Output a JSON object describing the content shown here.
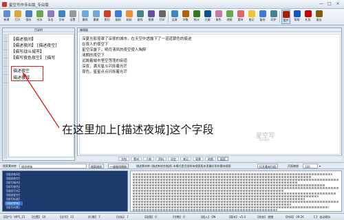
{
  "window": {
    "title": "星空写作专业版_专业版",
    "controls": [
      "—",
      "□",
      "×"
    ]
  },
  "toolbar": {
    "items": [
      {
        "label": "新建",
        "color": "#5b8fd6"
      },
      {
        "label": "打开",
        "color": "#e0a53a"
      },
      {
        "label": "保存",
        "color": "#4a7fc2"
      },
      {
        "label": "另存",
        "color": "#6aa84f"
      },
      {
        "label": "导出",
        "color": "#8e7cc3"
      },
      {
        "label": "字体",
        "color": "#3d85c6"
      },
      {
        "label": "设置",
        "color": "#999999"
      },
      {
        "label": "撤销",
        "color": "#6fa8dc"
      },
      {
        "label": "重做",
        "color": "#6fa8dc"
      },
      {
        "label": "剪切",
        "color": "#cc4125"
      },
      {
        "label": "复制",
        "color": "#3c78d8"
      },
      {
        "label": "粘贴",
        "color": "#e69138"
      },
      {
        "label": "查找",
        "color": "#45818e"
      },
      {
        "label": "替换",
        "color": "#674ea7"
      },
      {
        "label": "打印",
        "color": "#666666"
      },
      {
        "label": "全屏",
        "color": "#3d85c6"
      },
      {
        "label": "字数",
        "color": "#b45f06"
      },
      {
        "label": "统计",
        "color": "#38761d"
      },
      {
        "label": "大纲",
        "color": "#0b5394"
      },
      {
        "label": "角色",
        "color": "#c27ba0"
      },
      {
        "label": "地图",
        "color": "#6aa84f"
      },
      {
        "label": "素材",
        "color": "#e06666"
      },
      {
        "label": "笔记",
        "color": "#f1c232"
      },
      {
        "label": "备份",
        "color": "#3c78d8"
      },
      {
        "label": "同步",
        "color": "#45818e"
      },
      {
        "label": "用户",
        "color": "#a61c00"
      },
      {
        "label": "帮助",
        "color": "#1155cc"
      },
      {
        "label": "礼包",
        "color": "#cc0000"
      },
      {
        "label": "退出",
        "color": "#7f6000"
      }
    ],
    "active_index": 25
  },
  "left_pane": {
    "header": "目录树",
    "tree_items": [
      "【描述夜间】",
      "【描述夜间】 [描述夜空]",
      "【描写战斗城市】",
      "【描写夜色夜空】 [描写"
    ],
    "highlight_items": [
      "描述夜空",
      "描述夜城"
    ]
  },
  "right_pane": {
    "header": "编辑器",
    "lines": [
      "深夏光影笼罩了深夜的城市，在天空中透露下了一道道银色的痕迹",
      "在夜人的夜空下",
      "星空深露下，明月清风的夜空使人陶醉",
      "清朗的夜空下",
      "远眺着城市里空荡荡的街道",
      "深夜，满天星斗闪烁着光芒",
      "夜色，星星点点闪烁着光芒"
    ],
    "annotation": "在这里加上[描述夜城]这个字段",
    "watermark": "星空写",
    "watermark_sub": "写作软件"
  },
  "bottom_tabs": [
    "文档",
    "素材",
    "人物",
    "资料",
    "设定",
    "笔记",
    "背景",
    "地图",
    "搜索"
  ],
  "bottom_tabs_selected": 8,
  "search_bar": {
    "label": "搜索素材库",
    "input_value": "描述夜城",
    "button1": "搜索描述",
    "button2": "一键查找替换",
    "hint": "描述素材库 (描述库综合描述) 本模式是目前所有搜索版本里最好用的素材搜索",
    "button3": "打开素材引用",
    "zoom_label": "页面缩放",
    "zoom_value": "100"
  },
  "bottom_left_lines": [
    "【描述夜间】",
    "【描述夜空】",
    "【描写城市】",
    "【描写夜色】",
    "【描述月光】",
    "【描述星空】",
    "【描写街道】",
    "【描述夜城】",
    "【描写风景】"
  ],
  "bottom_left_highlight": 7,
  "status_bar": {
    "items": [
      "【用户】 VIP5_15",
      "【位置】 10",
      "【总字】 15",
      "【行数】 7",
      "【光标】 7",
      "【段落】 0",
      "【字数】 0",
      "【插入】 ON",
      "【版本】 v5.0",
      "【状态】 就绪",
      "【时间】 09:26",
      "【 】 自动保存"
    ]
  }
}
